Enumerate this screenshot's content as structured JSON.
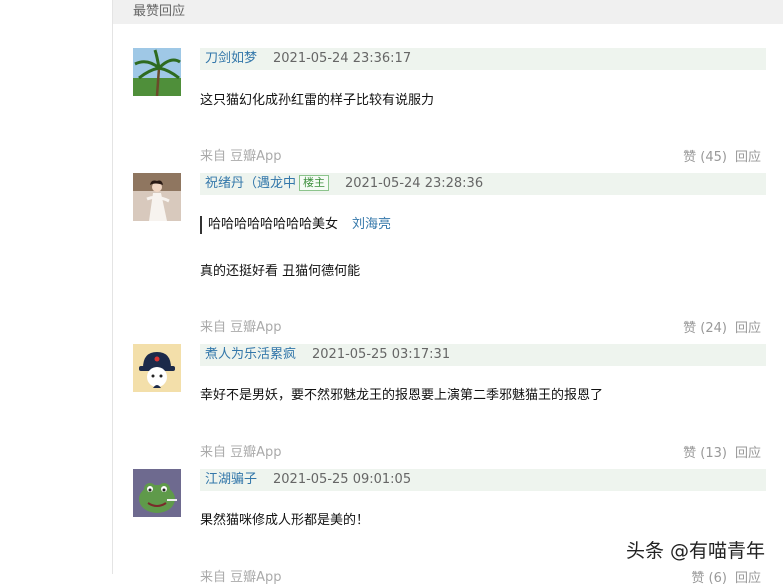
{
  "section": {
    "title": "最赞回应"
  },
  "comments": [
    {
      "author": "刀剑如梦",
      "time": "2021-05-24 23:36:17",
      "text": "这只猫幻化成孙红雷的样子比较有说服力",
      "source": "来自 豆瓣App",
      "likes": "赞 (45)",
      "reply": "回应"
    },
    {
      "author": "祝绪丹（遇龙中",
      "owner_tag": "楼主",
      "time": "2021-05-24 23:28:36",
      "quote_text": "哈哈哈哈哈哈哈哈美女",
      "quote_author": "刘海亮",
      "text": "真的还挺好看 丑猫何德何能",
      "source": "来自 豆瓣App",
      "likes": "赞 (24)",
      "reply": "回应"
    },
    {
      "author": "煮人为乐活累疯",
      "time": "2021-05-25 03:17:31",
      "text": "幸好不是男妖，要不然邪魅龙王的报恩要上演第二季邪魅猫王的报恩了",
      "source": "来自 豆瓣App",
      "likes": "赞 (13)",
      "reply": "回应"
    },
    {
      "author": "江湖骗子",
      "time": "2021-05-25 09:01:05",
      "text": "果然猫咪修成人形都是美的！",
      "source": "来自 豆瓣App",
      "likes": "赞 (6)",
      "reply": "回应"
    }
  ],
  "watermark": "头条 @有喵青年"
}
